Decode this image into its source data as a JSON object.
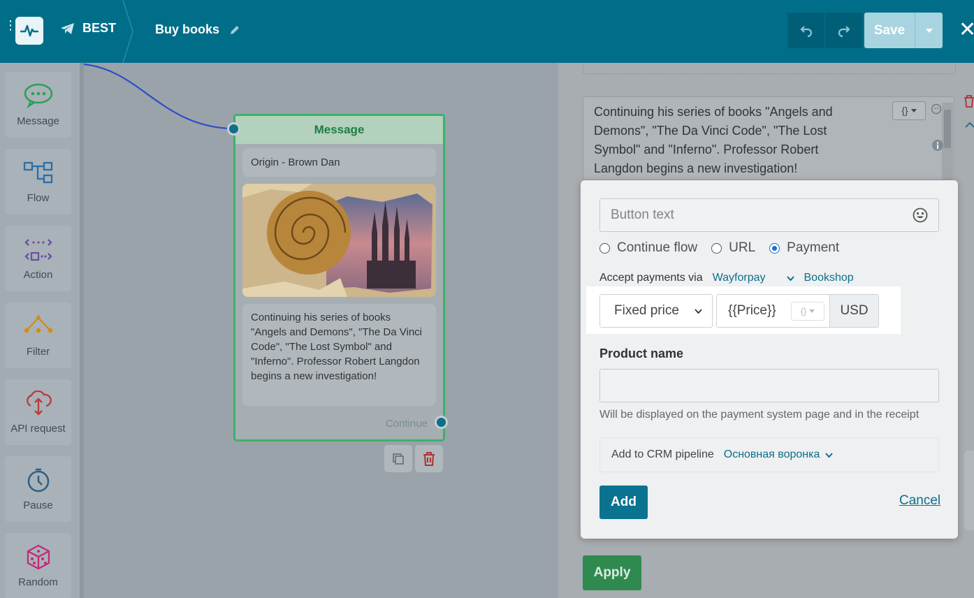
{
  "header": {
    "bot_name": "BEST",
    "flow_name": "Buy books",
    "save_label": "Save",
    "close_glyph": "✕"
  },
  "palette": {
    "items": [
      {
        "label": "Message",
        "icon": "message-icon",
        "color": "#2b9f58"
      },
      {
        "label": "Flow",
        "icon": "flow-icon",
        "color": "#2a6fa8"
      },
      {
        "label": "Action",
        "icon": "action-icon",
        "color": "#6b4fa0"
      },
      {
        "label": "Filter",
        "icon": "filter-icon",
        "color": "#d28a1d"
      },
      {
        "label": "API request",
        "icon": "api-request-icon",
        "color": "#b83a3a"
      },
      {
        "label": "Pause",
        "icon": "pause-icon",
        "color": "#2d5f82"
      },
      {
        "label": "Random",
        "icon": "random-icon",
        "color": "#c2297a"
      }
    ]
  },
  "node": {
    "title": "Message",
    "card1_text": "Origin - Brown Dan",
    "card2_text": "Continuing his series of books \"Angels and Demons\", \"The Da Vinci Code\", \"The Lost Symbol\" and \"Inferno\". Professor Robert Langdon begins a new investigation!",
    "continue_label": "Continue"
  },
  "panel": {
    "message_text": "Continuing his series of books \"Angels and Demons\", \"The Da Vinci Code\", \"The Lost Symbol\" and \"Inferno\". Professor Robert Langdon begins a new investigation!",
    "var_glyph": "{}",
    "apply_label": "Apply"
  },
  "popup": {
    "button_text_placeholder": "Button text",
    "radios": [
      {
        "label": "Continue flow",
        "checked": false
      },
      {
        "label": "URL",
        "checked": false
      },
      {
        "label": "Payment",
        "checked": true
      }
    ],
    "accept_label": "Accept payments via",
    "provider": "Wayforpay",
    "shop": "Bookshop",
    "price_type": "Fixed price",
    "price_value": "{{Price}}",
    "price_var_glyph": "{}",
    "currency": "USD",
    "product_name_label": "Product name",
    "product_name_value": "",
    "product_help": "Will be displayed on the payment system page and in the receipt",
    "crm_label": "Add to CRM pipeline",
    "crm_value": "Основная воронка",
    "add_label": "Add",
    "cancel_label": "Cancel"
  },
  "colors": {
    "header_bg": "#006e88",
    "accent": "#0a7390",
    "node_border": "#3bb26c",
    "apply_bg": "#2e8a4f"
  }
}
